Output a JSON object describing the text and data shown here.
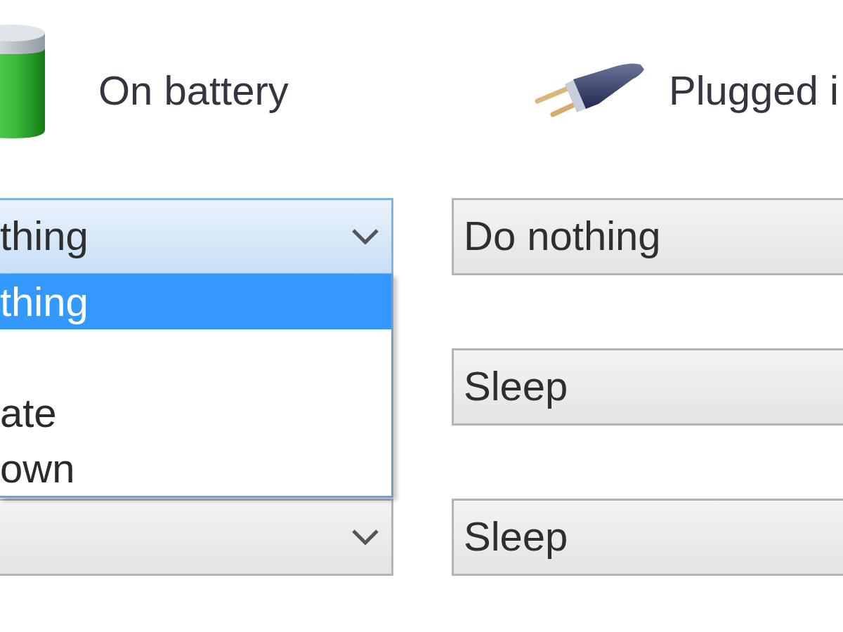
{
  "columns": [
    {
      "heading": "On battery",
      "kind": "battery"
    },
    {
      "heading": "Plugged i",
      "kind": "plug"
    }
  ],
  "settings": [
    {
      "on_battery": {
        "value": "thing",
        "expanded": true,
        "options": [
          {
            "label": "thing",
            "selected": true
          },
          {
            "selected": false
          },
          {
            "label": "ate",
            "selected": false
          },
          {
            "label": "own",
            "selected": false
          }
        ]
      },
      "plugged_in": {
        "value": "Do nothing",
        "expanded": false
      }
    },
    {
      "plugged_in": {
        "value": "Sleep",
        "expanded": false
      }
    },
    {
      "on_battery": {
        "expanded": false
      },
      "plugged_in": {
        "value": "Sleep",
        "expanded": false
      }
    }
  ]
}
